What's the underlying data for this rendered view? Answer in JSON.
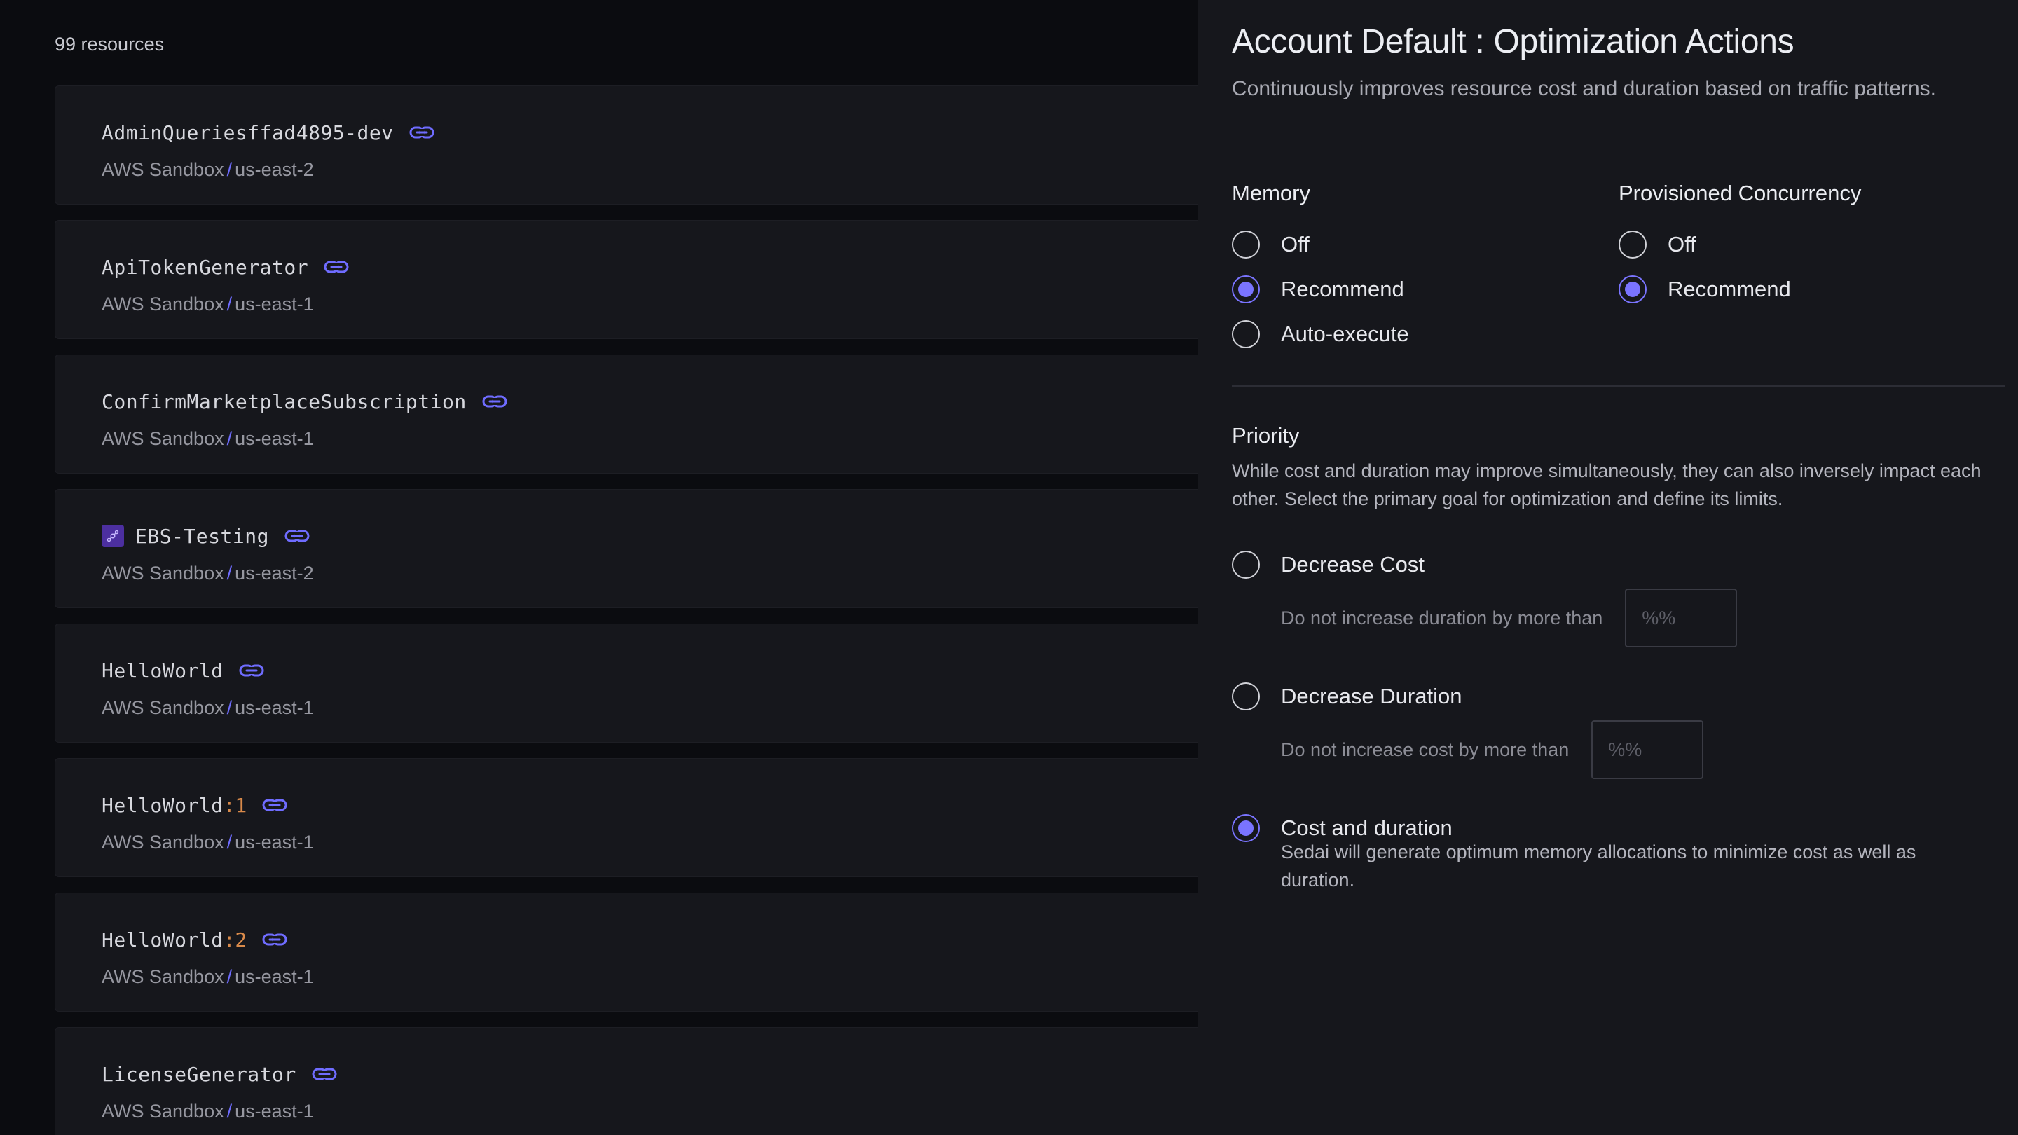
{
  "resources": {
    "count_label": "99 resources",
    "items": [
      {
        "name": "AdminQueriesffad4895-dev",
        "version": "",
        "account": "AWS Sandbox",
        "separator": "/",
        "region": "us-east-2",
        "tagged": false
      },
      {
        "name": "ApiTokenGenerator",
        "version": "",
        "account": "AWS Sandbox",
        "separator": "/",
        "region": "us-east-1",
        "tagged": false
      },
      {
        "name": "ConfirmMarketplaceSubscription",
        "version": "",
        "account": "AWS Sandbox",
        "separator": "/",
        "region": "us-east-1",
        "tagged": false
      },
      {
        "name": "EBS-Testing",
        "version": "",
        "account": "AWS Sandbox",
        "separator": "/",
        "region": "us-east-2",
        "tagged": true
      },
      {
        "name": "HelloWorld",
        "version": "",
        "account": "AWS Sandbox",
        "separator": "/",
        "region": "us-east-1",
        "tagged": false
      },
      {
        "name": "HelloWorld",
        "version": ":1",
        "account": "AWS Sandbox",
        "separator": "/",
        "region": "us-east-1",
        "tagged": false
      },
      {
        "name": "HelloWorld",
        "version": ":2",
        "account": "AWS Sandbox",
        "separator": "/",
        "region": "us-east-1",
        "tagged": false
      },
      {
        "name": "LicenseGenerator",
        "version": "",
        "account": "AWS Sandbox",
        "separator": "/",
        "region": "us-east-1",
        "tagged": false
      }
    ]
  },
  "panel": {
    "title": "Account Default : Optimization Actions",
    "subtitle": "Continuously improves resource cost and duration based on traffic patterns.",
    "memory": {
      "heading": "Memory",
      "options": [
        {
          "label": "Off",
          "selected": false
        },
        {
          "label": "Recommend",
          "selected": true
        },
        {
          "label": "Auto-execute",
          "selected": false
        }
      ]
    },
    "concurrency": {
      "heading": "Provisioned Concurrency",
      "options": [
        {
          "label": "Off",
          "selected": false
        },
        {
          "label": "Recommend",
          "selected": true
        }
      ]
    },
    "priority": {
      "heading": "Priority",
      "description": "While cost and duration may improve simultaneously, they can also inversely impact each other. Select the primary goal for optimization and define its limits.",
      "decrease_cost": {
        "label": "Decrease Cost",
        "selected": false,
        "limit_label": "Do not increase duration by more than",
        "placeholder": "%%"
      },
      "decrease_duration": {
        "label": "Decrease Duration",
        "selected": false,
        "limit_label": "Do not increase cost by more than",
        "placeholder": "%%"
      },
      "cost_and_duration": {
        "label": "Cost and duration",
        "selected": true,
        "description": "Sedai will generate optimum memory allocations to minimize cost as well as duration."
      }
    }
  },
  "colors": {
    "accent": "#7a74ff",
    "version": "#d98a4a",
    "tag": "#4c2fa0"
  },
  "icons": {
    "link": "link-icon",
    "tag": "tag-icon"
  }
}
